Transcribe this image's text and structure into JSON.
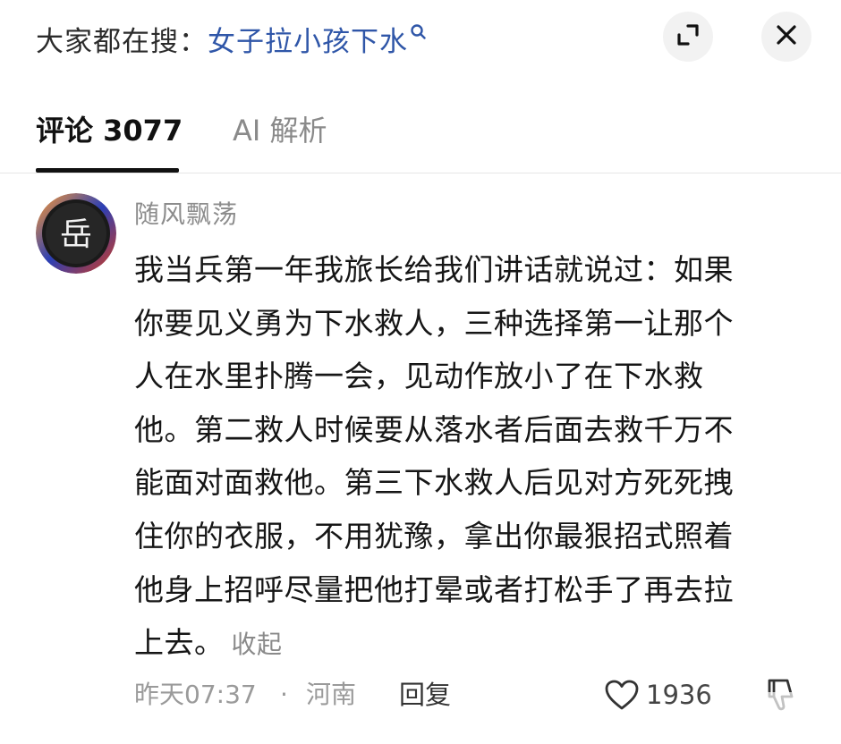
{
  "header": {
    "search_prefix": "大家都在搜：",
    "search_term": "女子拉小孩下水",
    "icons": {
      "search": "search-icon",
      "expand": "expand-icon",
      "close": "close-icon"
    }
  },
  "tabs": [
    {
      "label": "评论 3077",
      "active": true
    },
    {
      "label": "AI 解析",
      "active": false
    }
  ],
  "comment": {
    "avatar_glyph": "岳",
    "username": "随风飘荡",
    "lines": [
      "我当兵第一年我旅长给我们讲话就说过：如果",
      "你要见义勇为下水救人，三种选择第一让那个",
      "人在水里扑腾一会，见动作放小了在下水救",
      "他。第二救人时候要从落水者后面去救千万不",
      "能面对面救他。第三下水救人后见对方死死拽",
      "住你的衣服，不用犹豫，拿出你最狠招式照着",
      "他身上招呼尽量把他打晕或者打松手了再去拉",
      "上去。"
    ],
    "collapse_label": "收起",
    "time": "昨天07:37",
    "separator": "·",
    "location": "河南",
    "reply_label": "回复",
    "like_count": "1936"
  },
  "colors": {
    "search_term": "#2f56a8",
    "text_primary": "#161616",
    "text_secondary": "#8c8c8c",
    "tab_active": "#111111",
    "tab_inactive": "#8a8a8a",
    "button_bg": "#f2f2f2"
  }
}
